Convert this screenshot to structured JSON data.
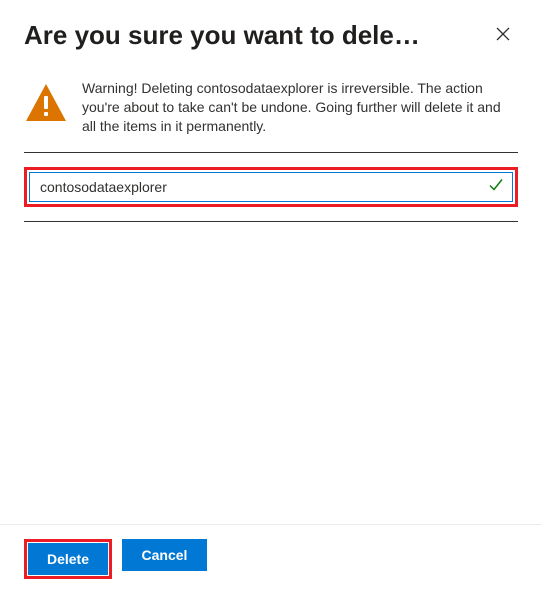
{
  "header": {
    "title": "Are you sure you want to dele…"
  },
  "warning": {
    "text": "Warning! Deleting contosodataexplorer is irreversible. The action you're about to take can't be undone. Going further will delete it and all the items in it permanently."
  },
  "input": {
    "value": "contosodataexplorer"
  },
  "footer": {
    "delete_label": "Delete",
    "cancel_label": "Cancel"
  },
  "colors": {
    "primary": "#0078d4",
    "highlight": "#ec1c24",
    "warning": "#db7500"
  }
}
